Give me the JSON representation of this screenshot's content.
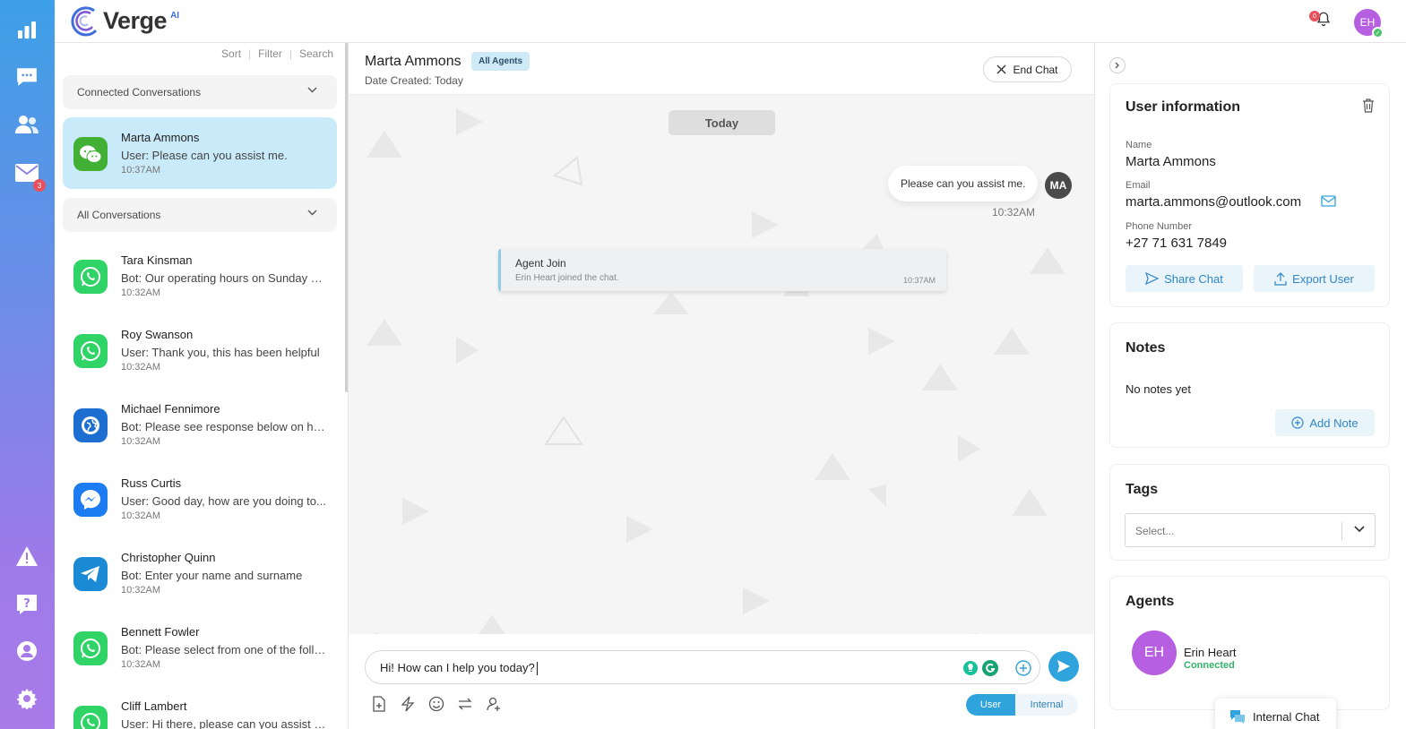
{
  "app": {
    "brand": "Verge",
    "brand_suffix": "AI",
    "notification_count": "0",
    "user_initials": "EH"
  },
  "rail": {
    "mail_badge": "3"
  },
  "list": {
    "tools": {
      "sort": "Sort",
      "filter": "Filter",
      "search": "Search"
    },
    "connected_label": "Connected Conversations",
    "all_label": "All Conversations",
    "connected": [
      {
        "name": "Marta Ammons",
        "message": "User: Please can you assist me.",
        "time": "10:37AM",
        "channel": "wechat"
      }
    ],
    "all": [
      {
        "name": "Tara Kinsman",
        "message": "Bot: Our operating hours on Sunday ar...",
        "time": "10:32AM",
        "channel": "whatsapp"
      },
      {
        "name": "Roy Swanson",
        "message": "User: Thank you, this has been helpful",
        "time": "10:32AM",
        "channel": "whatsapp"
      },
      {
        "name": "Michael Fennimore",
        "message": "Bot: Please see response below on ho...",
        "time": "10:32AM",
        "channel": "web"
      },
      {
        "name": "Russ Curtis",
        "message": "User: Good day, how are you doing to...",
        "time": "10:32AM",
        "channel": "messenger"
      },
      {
        "name": "Christopher Quinn",
        "message": "Bot: Enter your name and surname",
        "time": "10:32AM",
        "channel": "telegram"
      },
      {
        "name": "Bennett Fowler",
        "message": "Bot: Please select from one of the follo...",
        "time": "10:32AM",
        "channel": "whatsapp"
      },
      {
        "name": "Cliff Lambert",
        "message": "User: Hi there, please can you assist me",
        "time": "",
        "channel": "whatsapp"
      }
    ]
  },
  "chat": {
    "name": "Marta Ammons",
    "tag": "All Agents",
    "created": "Date Created: Today",
    "end_chat": "End Chat",
    "day_label": "Today",
    "user_message": "Please can you assist me.",
    "user_initials": "MA",
    "user_time": "10:32AM",
    "join_title": "Agent Join",
    "join_text": "Erin Heart joined the chat.",
    "join_time": "10:37AM",
    "input_value": "Hi! How can I help you today?",
    "mode_user": "User",
    "mode_internal": "Internal"
  },
  "user_info": {
    "title": "User information",
    "name_label": "Name",
    "name": "Marta Ammons",
    "email_label": "Email",
    "email": "marta.ammons@outlook.com",
    "phone_label": "Phone Number",
    "phone": "+27 71 631 7849",
    "share": "Share Chat",
    "export": "Export User"
  },
  "notes": {
    "title": "Notes",
    "empty": "No notes yet",
    "add": "Add Note"
  },
  "tags": {
    "title": "Tags",
    "placeholder": "Select..."
  },
  "agents": {
    "title": "Agents",
    "initials": "EH",
    "name": "Erin Heart",
    "status": "Connected"
  },
  "internal_chat": "Internal Chat",
  "colors": {
    "accent": "#2fa3dc",
    "active_row": "#c9eaf8",
    "avatar": "#b65fe0",
    "connected": "#34b36b"
  }
}
